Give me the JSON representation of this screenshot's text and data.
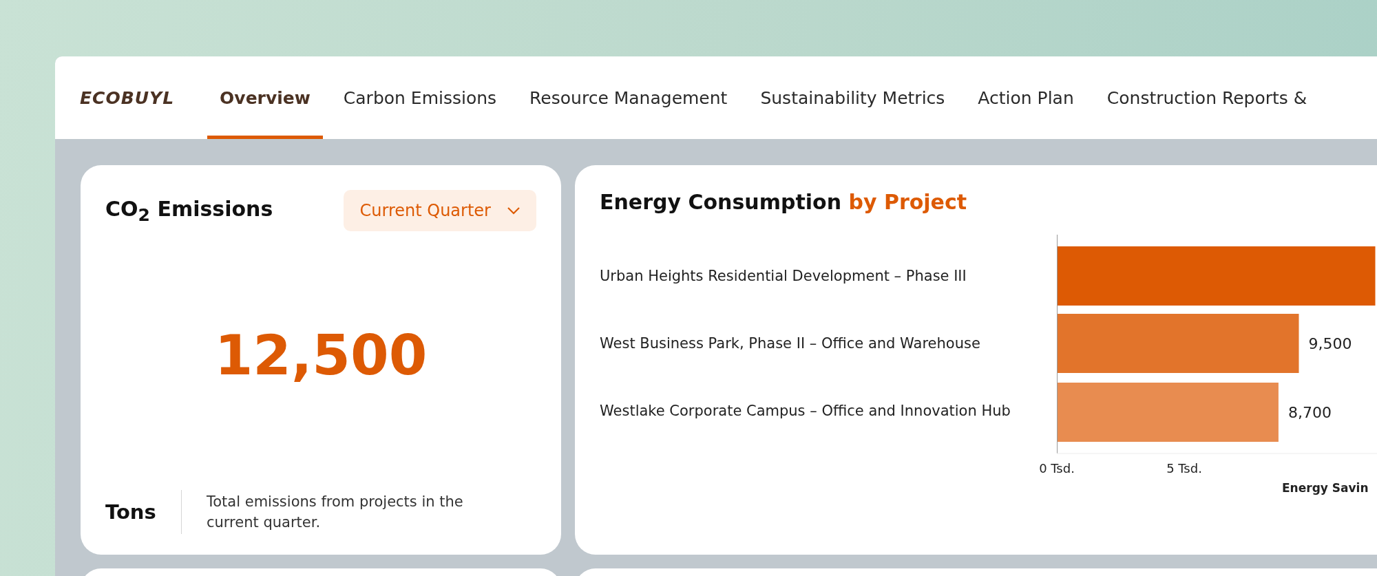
{
  "brand": {
    "logo": "ECOBUYL"
  },
  "tabs": [
    {
      "label": "Overview",
      "selected": true
    },
    {
      "label": "Carbon Emissions",
      "selected": false
    },
    {
      "label": "Resource Management",
      "selected": false
    },
    {
      "label": "Sustainability Metrics",
      "selected": false
    },
    {
      "label": "Action Plan",
      "selected": false
    },
    {
      "label": "Construction Reports &",
      "selected": false
    }
  ],
  "emissions_card": {
    "title": "CO$_{2}$ Emissions",
    "period_dropdown": "Current Quarter",
    "value": "12,500",
    "unit": "Tons",
    "description": "Total emissions from projects in the current quarter."
  },
  "energy_card": {
    "title": "Energy Consumption",
    "title_highlight": "by Project",
    "chart_data": {
      "type": "bar",
      "orientation": "horizontal",
      "categories": [
        "Urban Heights Residential Development – Phase III",
        "West Business Park, Phase II – Office and Warehouse",
        "Westlake Corporate Campus – Office and Innovation Hub"
      ],
      "series": [
        {
          "values": [
            12.5,
            9.5,
            8.7
          ]
        }
      ],
      "colors": [
        "#dd5a04",
        "#e2742b",
        "#e88c50"
      ],
      "value_labels": [
        null,
        "9,500",
        "8,700"
      ],
      "xticks": [
        {
          "value": 0,
          "label": "0 Tsd."
        },
        {
          "value": 5,
          "label": "5 Tsd."
        }
      ],
      "xlim": [
        0,
        15
      ],
      "xlabel": "Energy Savin"
    }
  }
}
